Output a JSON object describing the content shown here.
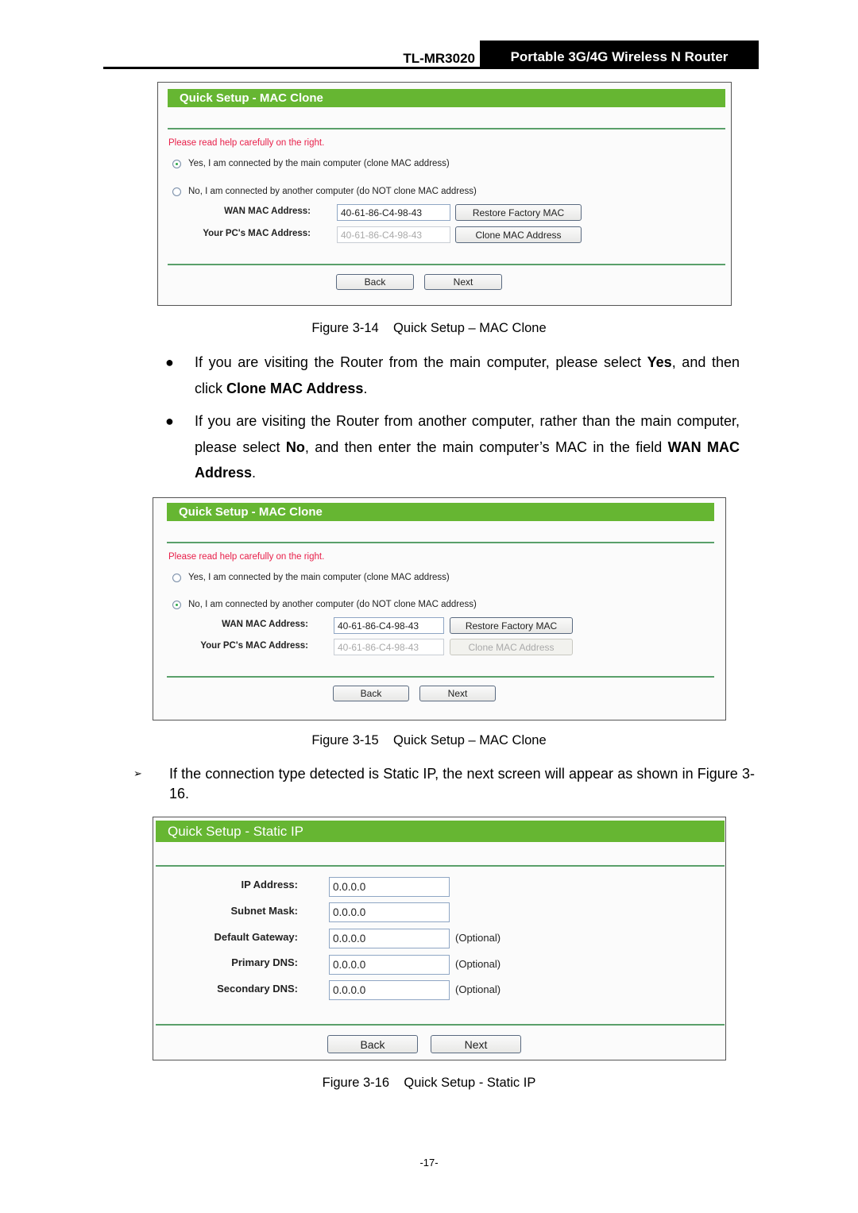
{
  "header": {
    "model": "TL-MR3020",
    "product": "Portable 3G/4G Wireless N Router"
  },
  "figure14": {
    "title": "Quick Setup - MAC Clone",
    "warning": "Please read help carefully on the right.",
    "radio_yes": {
      "label": "Yes, I am connected by the main computer (clone MAC address)",
      "checked": true
    },
    "radio_no": {
      "label": "No, I am connected by another computer (do NOT clone MAC address)",
      "checked": false
    },
    "wan_mac_label": "WAN MAC Address:",
    "wan_mac_value": "40-61-86-C4-98-43",
    "pc_mac_label": "Your PC's MAC Address:",
    "pc_mac_value": "40-61-86-C4-98-43",
    "restore_button": "Restore Factory MAC",
    "clone_button": "Clone MAC Address",
    "clone_enabled": true,
    "back_button": "Back",
    "next_button": "Next",
    "caption": "Figure 3-14    Quick Setup – MAC Clone"
  },
  "bullets": {
    "b1": {
      "pre": "If you are visiting the Router from the main computer, please select ",
      "bold1": "Yes",
      "mid": ", and then click ",
      "bold2": "Clone MAC Address",
      "post": "."
    },
    "b2": {
      "pre": "If you are visiting the Router from another computer, rather than the main computer, please select ",
      "bold1": "No",
      "mid": ", and then enter the main computer’s MAC in the field ",
      "bold2": "WAN MAC Address",
      "post": "."
    }
  },
  "figure15": {
    "title": "Quick Setup - MAC Clone",
    "warning": "Please read help carefully on the right.",
    "radio_yes": {
      "label": "Yes, I am connected by the main computer (clone MAC address)",
      "checked": false
    },
    "radio_no": {
      "label": "No, I am connected by another computer (do NOT clone MAC address)",
      "checked": true
    },
    "wan_mac_label": "WAN MAC Address:",
    "wan_mac_value": "40-61-86-C4-98-43",
    "pc_mac_label": "Your PC's MAC Address:",
    "pc_mac_value": "40-61-86-C4-98-43",
    "restore_button": "Restore Factory MAC",
    "clone_button": "Clone MAC Address",
    "clone_enabled": false,
    "back_button": "Back",
    "next_button": "Next",
    "caption": "Figure 3-15    Quick Setup – MAC Clone"
  },
  "arrow_para": {
    "marker": "➢",
    "text": "If the connection type detected is Static IP, the next screen will appear as shown in Figure 3-16."
  },
  "figure16": {
    "title": "Quick Setup - Static IP",
    "fields": [
      {
        "label": "IP Address:",
        "value": "0.0.0.0",
        "note": ""
      },
      {
        "label": "Subnet Mask:",
        "value": "0.0.0.0",
        "note": ""
      },
      {
        "label": "Default Gateway:",
        "value": "0.0.0.0",
        "note": "(Optional)"
      },
      {
        "label": "Primary DNS:",
        "value": "0.0.0.0",
        "note": "(Optional)"
      },
      {
        "label": "Secondary DNS:",
        "value": "0.0.0.0",
        "note": "(Optional)"
      }
    ],
    "back_button": "Back",
    "next_button": "Next",
    "caption": "Figure 3-16    Quick Setup - Static IP"
  },
  "page_number": "-17-"
}
